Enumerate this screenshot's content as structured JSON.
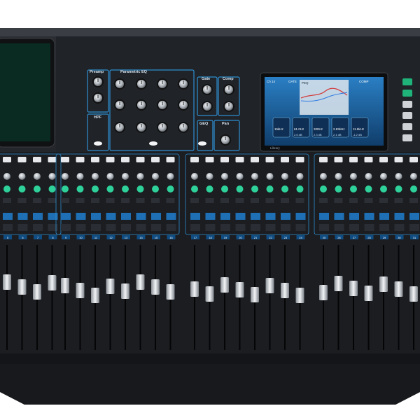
{
  "image": {
    "subject": "mixing-console",
    "colors": {
      "background": "#ffffff",
      "body": "#1c1e22",
      "panel": "#23262b",
      "accent": "#2e8fd0",
      "screen": "#1a5f9e",
      "knob": "#c9cdd2",
      "fader": "#d9dde2",
      "led_green": "#2fd19a",
      "label_blue": "#7ec3f0"
    }
  },
  "labels": {
    "preamp": "Preamp",
    "parametric_eq": "Parametric EQ",
    "gate": "Gate",
    "comp": "Comp",
    "hpf": "HPF",
    "geq": "GEQ",
    "pan": "Pan",
    "screen_channel": "Ch 14",
    "screen_gate": "GATE",
    "screen_peq": "PEQ",
    "screen_comp": "COMP",
    "screen_params": [
      "15kHz",
      "61.0Hz",
      "200Hz",
      "2.83kHz",
      "11.8kHz"
    ],
    "screen_gains": [
      "",
      "2.6 dB",
      "2.3 dB",
      "2.1 dB",
      "-1.2 dB"
    ],
    "screen_bottom": "Library"
  },
  "channels": {
    "count": 27,
    "bank_1_numbers": [
      "5",
      "6",
      "7",
      "8"
    ],
    "bank_2_numbers": [
      "9",
      "10",
      "11",
      "12",
      "13",
      "14",
      "15",
      "16"
    ],
    "bank_3_numbers": [
      "17",
      "18",
      "19",
      "20",
      "21",
      "22",
      "23",
      "24"
    ],
    "bank_4_numbers": [
      "25",
      "26",
      "27",
      "28",
      "29",
      "30",
      "31"
    ]
  }
}
